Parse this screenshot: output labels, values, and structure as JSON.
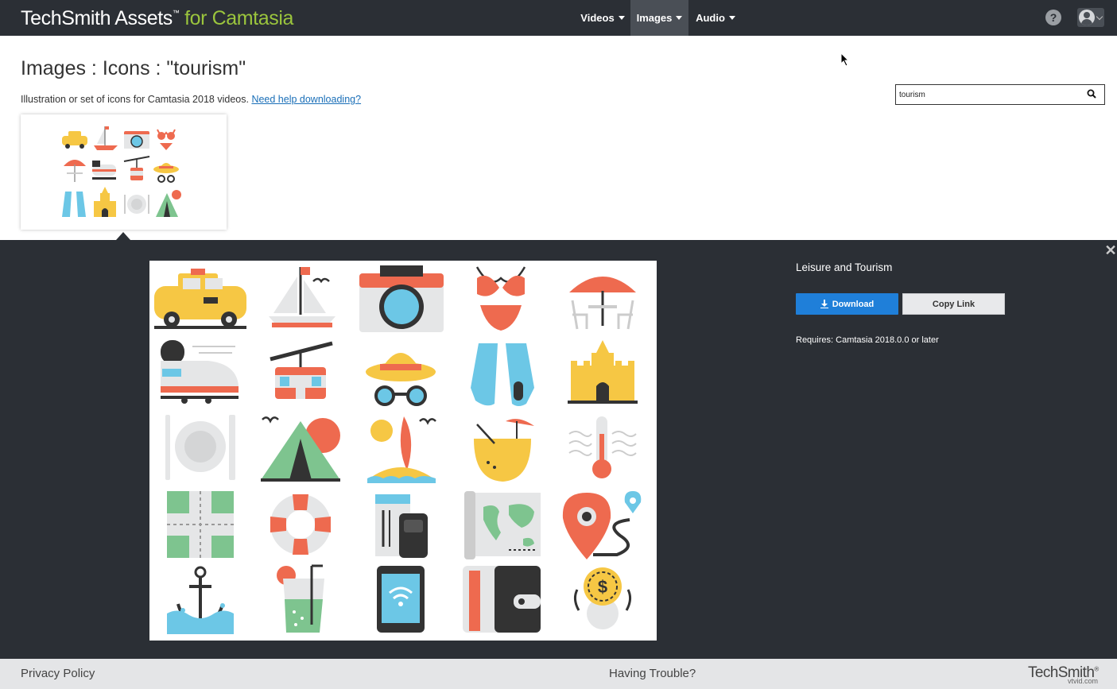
{
  "header": {
    "brand_main": "TechSmith Assets",
    "brand_tm": "™",
    "brand_accent": "for Camtasia",
    "nav": [
      {
        "label": "Videos",
        "active": false
      },
      {
        "label": "Images",
        "active": true
      },
      {
        "label": "Audio",
        "active": false
      }
    ],
    "help_glyph": "?",
    "icons": [
      "help-icon",
      "account-avatar-icon",
      "chevron-down-icon"
    ]
  },
  "page": {
    "title": "Images : Icons : \"tourism\"",
    "subtitle": "Illustration or set of icons for Camtasia 2018 videos.",
    "help_link": "Need help downloading?"
  },
  "search": {
    "value": "tourism",
    "icon": "search-icon"
  },
  "result": {
    "icon_grid": [
      "taxi",
      "sailboat",
      "camera",
      "bikini",
      "beach-umbrella",
      "bullet-train",
      "cable-car",
      "sun-hat",
      "flippers",
      "sand-castle",
      "plate-and-cutlery",
      "tent"
    ]
  },
  "detail": {
    "asset_title": "Leisure and Tourism",
    "download_label": "Download",
    "copy_link_label": "Copy Link",
    "requirements": "Requires: Camtasia 2018.0.0 or later",
    "close_glyph": "✕",
    "preview_icons": [
      "taxi",
      "sailboat",
      "camera",
      "bikini",
      "beach-table-umbrella",
      "bullet-train",
      "cable-car",
      "sun-hat-sunglasses",
      "swim-flippers",
      "sand-castle",
      "plate-and-cutlery",
      "tent",
      "surfboard-island",
      "coconut-drink",
      "thermometer",
      "crossroads",
      "lifebuoy",
      "ticket-and-phone",
      "world-map",
      "location-pin-route",
      "anchor",
      "cocktail-glass",
      "tablet-wifi",
      "wallet",
      "coin"
    ]
  },
  "footer": {
    "privacy": "Privacy Policy",
    "trouble": "Having Trouble?",
    "logo": "TechSmith",
    "logo_tm": "®",
    "watermark": "vtvid.com"
  },
  "colors": {
    "topbar": "#2b2f35",
    "accent_green": "#9bc53d",
    "download_blue": "#1f7fd9",
    "link_blue": "#1a6fb8",
    "footer_bg": "#e4e5e7"
  }
}
